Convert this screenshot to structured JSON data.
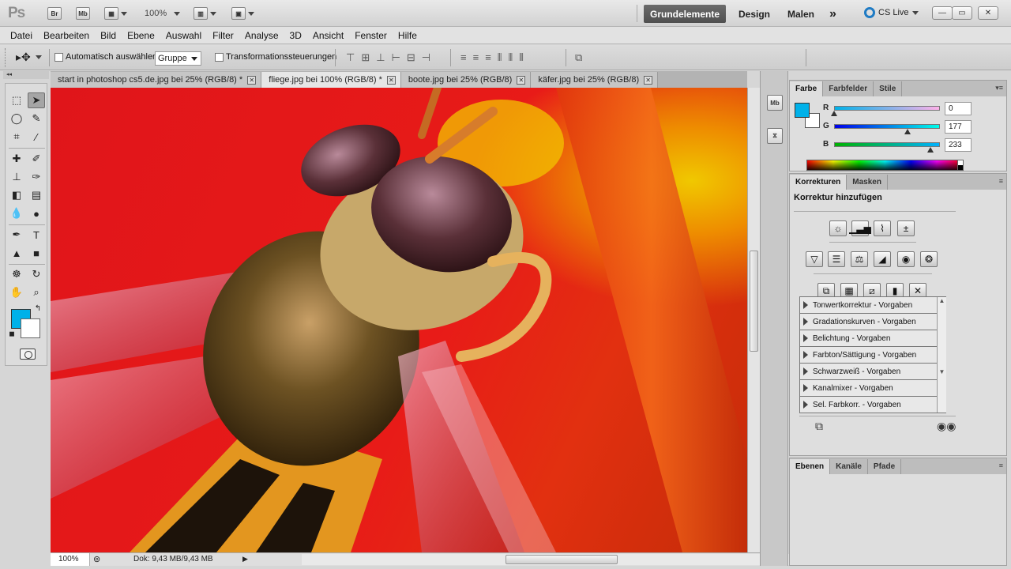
{
  "app": {
    "logo": "Ps",
    "bridge": "Br",
    "minibridge": "Mb",
    "zoom": "100%",
    "workspaces": [
      "Grundelemente",
      "Design",
      "Malen"
    ],
    "more": "»",
    "cs_live": "CS Live",
    "window_controls": [
      "—",
      "▭",
      "✕"
    ]
  },
  "menu": [
    "Datei",
    "Bearbeiten",
    "Bild",
    "Ebene",
    "Auswahl",
    "Filter",
    "Analyse",
    "3D",
    "Ansicht",
    "Fenster",
    "Hilfe"
  ],
  "options": {
    "auto_select_label": "Automatisch auswählen:",
    "auto_select_value": "Gruppe",
    "transform_label": "Transformationssteuerungen"
  },
  "tabs": [
    {
      "label": "start in photoshop cs5.de.jpg bei 25% (RGB/8) *",
      "active": false
    },
    {
      "label": "fliege.jpg bei 100% (RGB/8) *",
      "active": true
    },
    {
      "label": "boote.jpg bei 25% (RGB/8)",
      "active": false
    },
    {
      "label": "käfer.jpg bei 25% (RGB/8)",
      "active": false
    }
  ],
  "status": {
    "zoom": "100%",
    "doc_info": "Dok: 9,43 MB/9,43 MB"
  },
  "colors": {
    "foreground": "#00b1e9",
    "background": "#ffffff",
    "accent_dark": "#4f4f4f"
  },
  "color_panel": {
    "tabs": [
      "Farbe",
      "Farbfelder",
      "Stile"
    ],
    "channels": [
      {
        "label": "R",
        "value": "0",
        "level": 0.0
      },
      {
        "label": "G",
        "value": "177",
        "level": 0.694
      },
      {
        "label": "B",
        "value": "233",
        "level": 0.914
      }
    ]
  },
  "adjust_panel": {
    "tabs": [
      "Korrekturen",
      "Masken"
    ],
    "title": "Korrektur hinzufügen",
    "presets": [
      "Tonwertkorrektur - Vorgaben",
      "Gradationskurven - Vorgaben",
      "Belichtung - Vorgaben",
      "Farbton/Sättigung - Vorgaben",
      "Schwarzweiß - Vorgaben",
      "Kanalmixer - Vorgaben",
      "Sel. Farbkorr. - Vorgaben"
    ]
  },
  "layers_panel": {
    "tabs": [
      "Ebenen",
      "Kanäle",
      "Pfade"
    ]
  }
}
